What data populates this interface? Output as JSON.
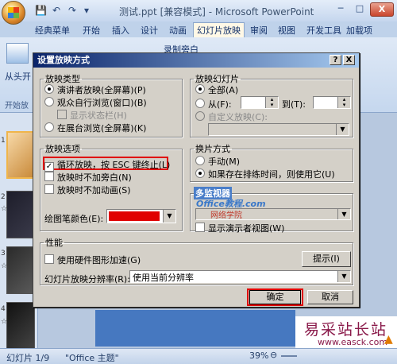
{
  "window": {
    "title": "测试.ppt [兼容模式] - Microsoft PowerPoint",
    "min": "─",
    "max": "□",
    "close": "X",
    "qat_save": "💾",
    "qat_undo": "↶",
    "qat_redo": "↷",
    "qat_more": "▾"
  },
  "ribbon_tabs": [
    "经典菜单",
    "开始",
    "插入",
    "设计",
    "动画",
    "幻灯片放映",
    "审阅",
    "视图",
    "开发工具",
    "加载项"
  ],
  "ribbon_active_tab": "幻灯片放映",
  "ribbon_group": {
    "from_start": "从头开",
    "start_group": "开始放",
    "record": "录制旁白"
  },
  "slides": {
    "n1": "1",
    "n2": "2",
    "n3": "3",
    "n4": "4",
    "star": "☆"
  },
  "status": {
    "slide": "幻灯片 1/9",
    "theme": "\"Office 主题\"",
    "zoom": "39%",
    "minus": "⊖",
    "plus": "⊕"
  },
  "watermark": {
    "text": "易采站长站",
    "url": "www.easck.com"
  },
  "dialog": {
    "title": "设置放映方式",
    "help": "?",
    "close": "X",
    "show_type": {
      "legend": "放映类型",
      "presenter": "演讲者放映(全屏幕)(P)",
      "browsed_window": "观众自行浏览(窗口)(B)",
      "show_scrollbar": "显示状态栏(H)",
      "kiosk": "在展台浏览(全屏幕)(K)"
    },
    "slides_range": {
      "legend": "放映幻灯片",
      "all": "全部(A)",
      "from": "从(F):",
      "to": "到(T):",
      "custom": "自定义放映(C):"
    },
    "options": {
      "legend": "放映选项",
      "loop": "循环放映，按 ESC 键终止(L)",
      "no_narration": "放映时不加旁白(N)",
      "no_animation": "放映时不加动画(S)",
      "pen_color": "绘图笔颜色(E):",
      "pen_color_value": "#e00000"
    },
    "advance": {
      "legend": "换片方式",
      "manual": "手动(M)",
      "timings": "如果存在排练时间，则使用它(U)"
    },
    "multi_monitor": {
      "legend": "多监视器",
      "watermark_site": "Office教程.com",
      "watermark_sub": "网络学院",
      "show_presenter_view": "显示演示者视图(W)"
    },
    "performance": {
      "legend": "性能",
      "hw_accel": "使用硬件图形加速(G)",
      "tips": "提示(I)",
      "resolution_label": "幻灯片放映分辨率(R):",
      "resolution_value": "使用当前分辨率"
    },
    "ok": "确定",
    "cancel": "取消"
  }
}
